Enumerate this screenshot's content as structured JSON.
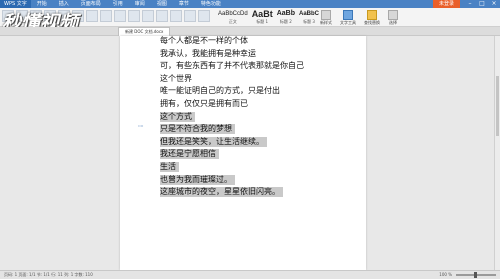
{
  "app": {
    "menu_button": "WPS 文字",
    "tabs": [
      "开始",
      "插入",
      "页面布局",
      "引用",
      "审阅",
      "视图",
      "章节",
      "特色功能"
    ],
    "login": "未登录"
  },
  "logo_text": "秒懂视频",
  "ribbon": {
    "styles": [
      {
        "sample": "AaBbCcDd",
        "caption": "正文"
      },
      {
        "sample": "AaBt",
        "caption": "标题 1"
      },
      {
        "sample": "AaBb",
        "caption": "标题 2"
      },
      {
        "sample": "AaBbC",
        "caption": "标题 3"
      }
    ],
    "tools": [
      {
        "label": "新样式",
        "icon": "new-style-icon"
      },
      {
        "label": "文字工具",
        "icon": "text-tool-icon"
      },
      {
        "label": "查找替换",
        "icon": "find-replace-icon"
      },
      {
        "label": "选择",
        "icon": "select-icon"
      }
    ]
  },
  "doc_tab": "新建 DOC 文档.docx",
  "document": {
    "lines": [
      {
        "text": "每个人都是不一样的个体",
        "selected": false
      },
      {
        "text": "我承认，我能拥有是种幸运",
        "selected": false
      },
      {
        "text": "可，有些东西有了并不代表那就是你自己",
        "selected": false
      },
      {
        "text": "这个世界",
        "selected": false
      },
      {
        "text": "唯一能证明自己的方式，只是付出",
        "selected": false
      },
      {
        "text": "拥有，仅仅只是拥有而已",
        "selected": false
      },
      {
        "text": "这个方式",
        "selected": true
      },
      {
        "text": "只是不符合我的梦想",
        "selected": true
      },
      {
        "text": "但我还是笑笑，让生活继续。",
        "selected": true
      },
      {
        "text": "我还是宁愿相信",
        "selected": true
      },
      {
        "text": "生活",
        "selected": true
      },
      {
        "text": "也曾为我而璀璨过。",
        "selected": true
      },
      {
        "text": "这座城市的夜空，星星依旧闪亮。",
        "selected": true
      }
    ]
  },
  "status": {
    "left": "页码: 1  页面: 1/1  节: 1/1  行: 11  列: 1  字数: 110",
    "zoom": "100 %"
  }
}
